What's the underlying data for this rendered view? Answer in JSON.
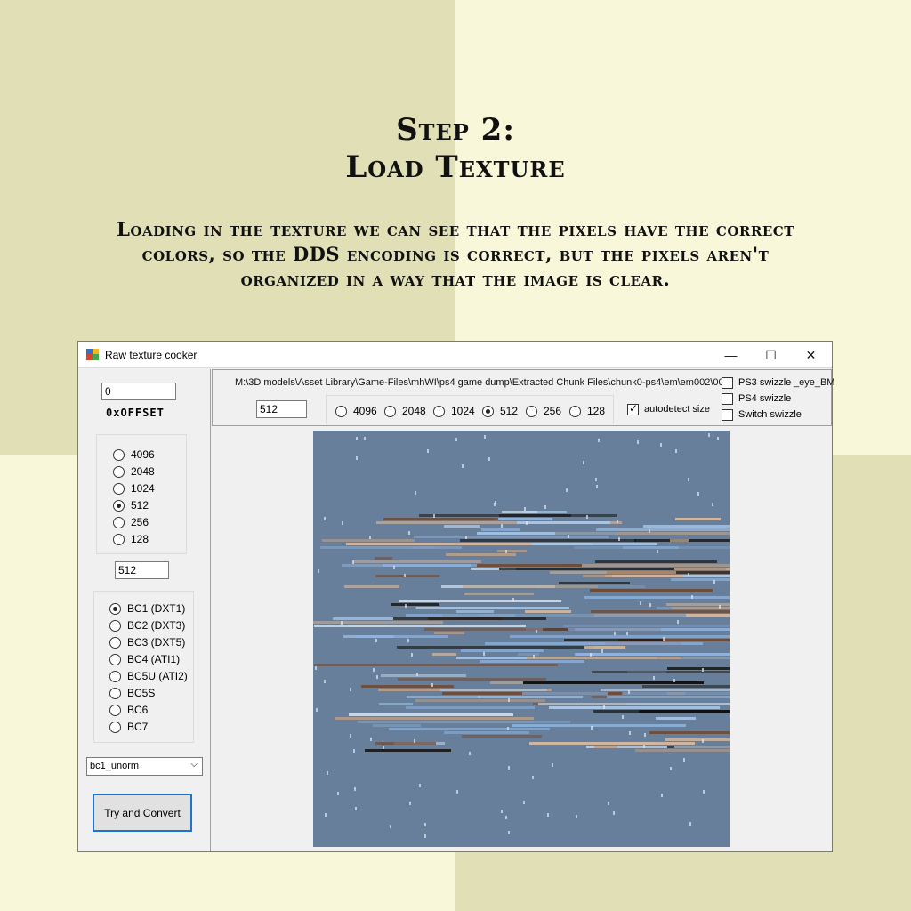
{
  "heading": {
    "line1": "Step 2:",
    "line2": "Load Texture",
    "description": "Loading in the texture we can see that the pixels have the correct colors, so the DDS encoding is correct, but the pixels aren't organized in a way that the image is clear."
  },
  "window": {
    "title": "Raw texture cooker",
    "minimize_glyph": "—",
    "maximize_glyph": "☐",
    "close_glyph": "✕"
  },
  "left_panel": {
    "offset_value": "0",
    "offset_label": "0xOFFSET",
    "size_options": [
      "4096",
      "2048",
      "1024",
      "512",
      "256",
      "128"
    ],
    "size_selected": "512",
    "size_value": "512",
    "format_options": [
      "BC1 (DXT1)",
      "BC2 (DXT3)",
      "BC3 (DXT5)",
      "BC4 (ATI1)",
      "BC5U (ATI2)",
      "BC5S",
      "BC6",
      "BC7"
    ],
    "format_selected": "BC1 (DXT1)",
    "dropdown_value": "bc1_unorm",
    "convert_button": "Try and Convert"
  },
  "top_panel": {
    "path": "M:\\3D models\\Asset Library\\Game-Files\\mhWI\\ps4 game dump\\Extracted Chunk Files\\chunk0-ps4\\em\\em002\\00",
    "path_suffix": "_eye_BM",
    "width_value": "512",
    "size_options": [
      "4096",
      "2048",
      "1024",
      "512",
      "256",
      "128"
    ],
    "size_selected": "512",
    "autodetect_label": "autodetect size",
    "autodetect_checked": true,
    "swizzle_options": [
      "PS3 swizzle",
      "PS4 swizzle",
      "Switch swizzle"
    ]
  },
  "colors": {
    "bg_dark": "#e0dfb6",
    "bg_light": "#f9f7d9",
    "texture_base": "#677f9b",
    "focus_blue": "#1e73c9"
  }
}
